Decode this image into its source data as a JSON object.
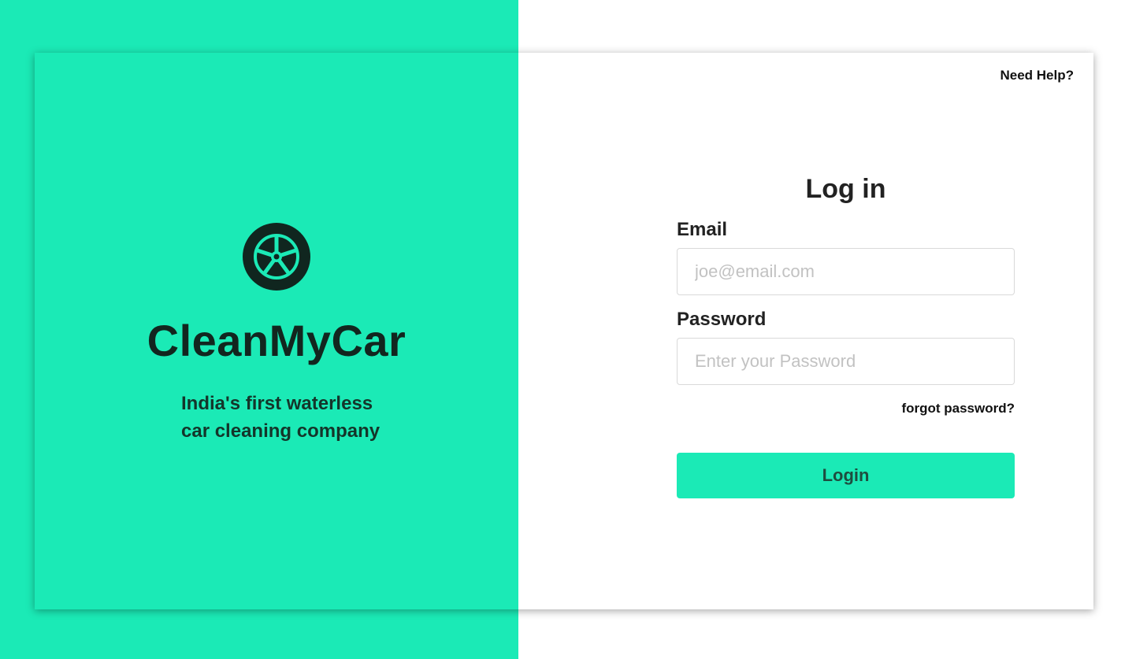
{
  "colors": {
    "accent": "#1BEAB6",
    "dark": "#10261f",
    "white": "#ffffff"
  },
  "brand": {
    "logo_icon": "car-wheel-icon",
    "name": "CleanMyCar",
    "tagline_line1": "India's first waterless",
    "tagline_line2": "car cleaning company"
  },
  "header": {
    "help_label": "Need Help?"
  },
  "login_form": {
    "title": "Log in",
    "email": {
      "label": "Email",
      "value": "",
      "placeholder": "joe@email.com"
    },
    "password": {
      "label": "Password",
      "value": "",
      "placeholder": "Enter your Password"
    },
    "forgot_label": "forgot password?",
    "submit_label": "Login"
  }
}
